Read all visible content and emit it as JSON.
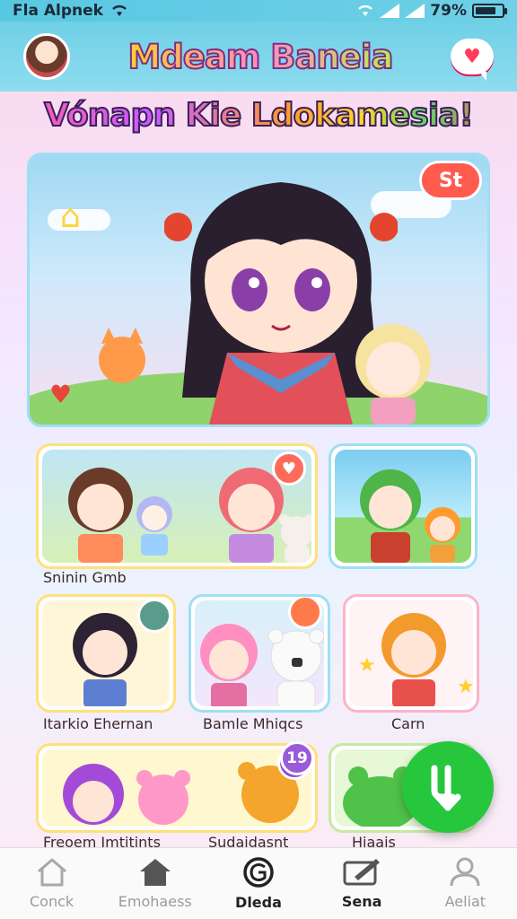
{
  "status_bar": {
    "carrier": "Fla Alpnek",
    "battery_text": "79%",
    "battery_level": 0.79
  },
  "header": {
    "title": "Mdeam Baneia",
    "chat_icon": "heart-chat-icon"
  },
  "headline": "Vónapn Kie Ldokamesia!",
  "hero": {
    "badge": "St"
  },
  "cards": [
    {
      "label": "Sninin Gmb"
    },
    {
      "label": ""
    },
    {
      "label": "Itarkio Ehernan",
      "badge": ""
    },
    {
      "label": "Bamle Mhiqcs",
      "badge": ""
    },
    {
      "label": "Carn"
    },
    {
      "label": "Freoem Jmtitints",
      "badge": ""
    },
    {
      "label": "Sudaidasnt",
      "badge": "19"
    },
    {
      "label": "Hiaais"
    }
  ],
  "bottom_nav": [
    {
      "label": "Conck",
      "icon": "home-outline-icon"
    },
    {
      "label": "Emohaess",
      "icon": "home-filled-icon"
    },
    {
      "label": "Dleda",
      "icon": "circle-g-icon"
    },
    {
      "label": "Sena",
      "icon": "card-edit-icon"
    },
    {
      "label": "Aeliat",
      "icon": "person-icon"
    }
  ]
}
